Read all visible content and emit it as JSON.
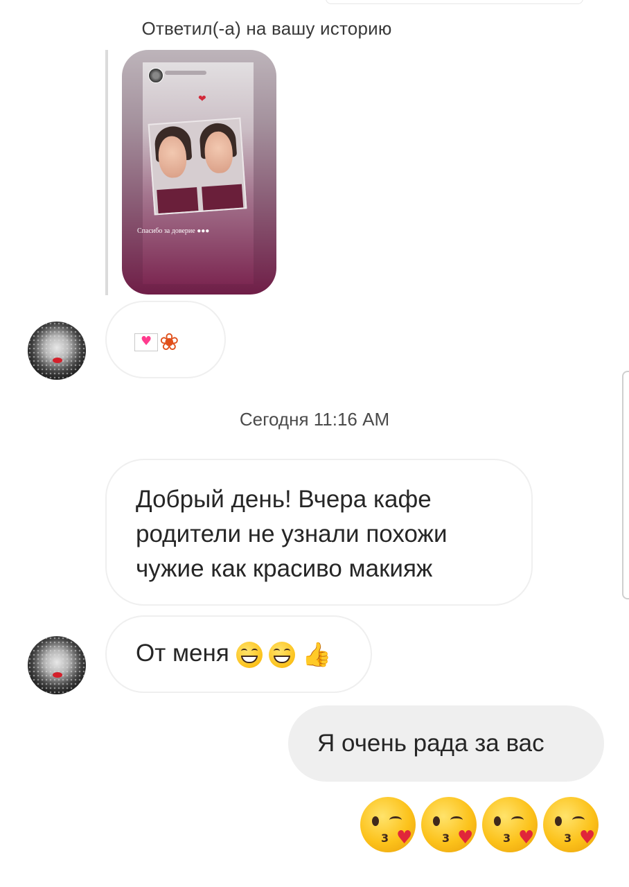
{
  "reply_caption": "Ответил(-а) на вашу историю",
  "story": {
    "caption": "Спасибо за доверие",
    "caption_emoji_icons": [
      "kissing-face-icon",
      "kissing-face-icon",
      "kissing-face-icon"
    ]
  },
  "timestamp": "Сегодня 11:16 AM",
  "messages": [
    {
      "side": "incoming",
      "icons": [
        "love-letter-icon",
        "maple-leaf-icon"
      ]
    },
    {
      "side": "incoming",
      "lines": [
        "Добрый день! Вчера кафе",
        "родители не узнали похожи",
        "чужие как красиво макияж"
      ]
    },
    {
      "side": "incoming",
      "text": "От меня",
      "icons": [
        "grinning-face-icon",
        "grinning-face-icon",
        "thumbs-up-icon"
      ]
    },
    {
      "side": "outgoing",
      "text": "Я очень рада за вас"
    },
    {
      "side": "outgoing",
      "icons": [
        "face-blowing-kiss-icon",
        "face-blowing-kiss-icon",
        "face-blowing-kiss-icon",
        "face-blowing-kiss-icon"
      ]
    }
  ],
  "colors": {
    "incoming_border": "#efefef",
    "outgoing_bg": "#efefef",
    "text": "#262626"
  }
}
